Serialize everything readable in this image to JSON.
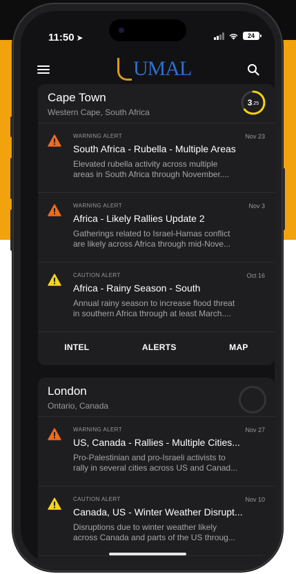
{
  "status": {
    "time": "11:50",
    "battery": "24"
  },
  "app": {
    "logo_text": "UMAL"
  },
  "cards": [
    {
      "city": "Cape Town",
      "region": "Western Cape, South Africa",
      "score_main": "3",
      "score_sub": ".25",
      "alerts": [
        {
          "kind": "WARNING ALERT",
          "date": "Nov 23",
          "title": "South Africa - Rubella - Multiple Areas",
          "line1": "Elevated rubella activity across multiple",
          "line2": "areas in South Africa through November...."
        },
        {
          "kind": "WARNING ALERT",
          "date": "Nov 3",
          "title": "Africa - Likely Rallies Update 2",
          "line1": "Gatherings related to Israel-Hamas conflict",
          "line2": "are likely across Africa through mid-Nove..."
        },
        {
          "kind": "CAUTION ALERT",
          "date": "Oct 16",
          "title": "Africa - Rainy Season - South",
          "line1": "Annual rainy season to increase flood threat",
          "line2": "in southern Africa through at least March...."
        }
      ],
      "tabs": [
        "INTEL",
        "ALERTS",
        "MAP"
      ]
    },
    {
      "city": "London",
      "region": "Ontario, Canada",
      "alerts": [
        {
          "kind": "WARNING ALERT",
          "date": "Nov 27",
          "title": "US, Canada - Rallies - Multiple Cities...",
          "line1": "Pro-Palestinian and pro-Israeli activists to",
          "line2": "rally in several cities across US and Canad..."
        },
        {
          "kind": "CAUTION ALERT",
          "date": "Nov 10",
          "title": "Canada, US - Winter Weather Disrupt...",
          "line1": "Disruptions due to winter weather likely",
          "line2": "across Canada and parts of the US throug..."
        }
      ]
    }
  ],
  "colors": {
    "warning": "#f26a1b",
    "caution": "#f5d31a",
    "score_ring": "#f2d414",
    "background_accent": "#f2a20c"
  }
}
